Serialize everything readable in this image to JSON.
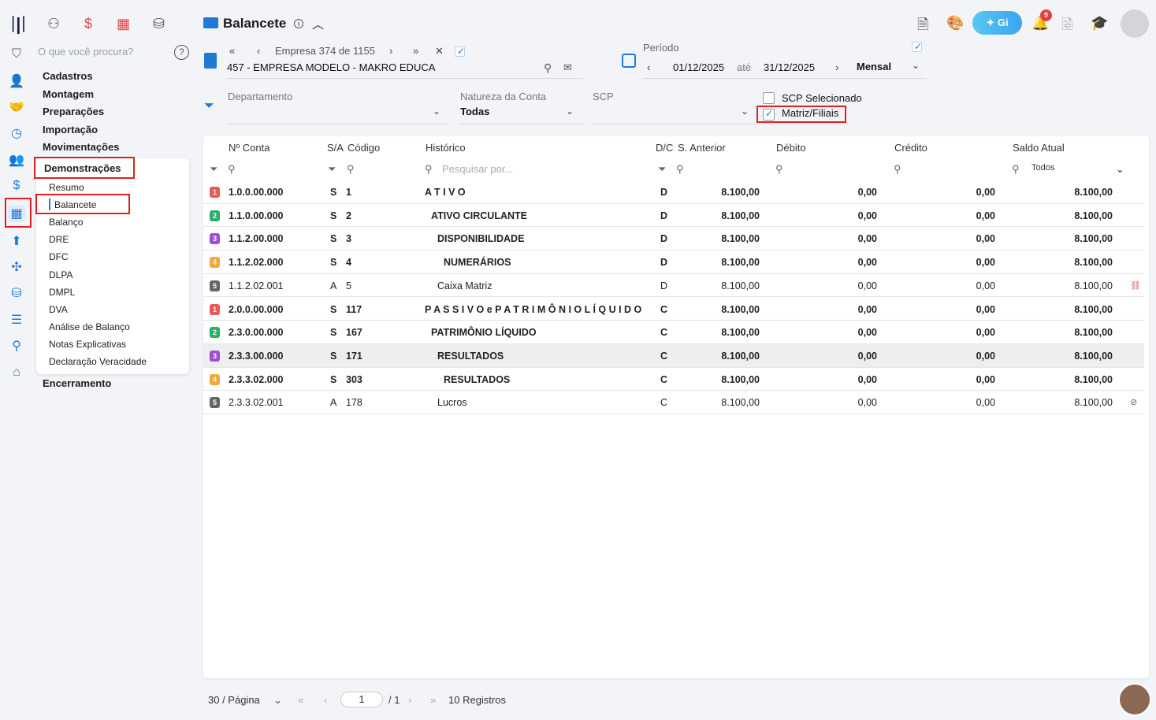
{
  "header": {
    "title": "Balancete",
    "company_nav": "Empresa 374 de 1155",
    "company_name": "457 - EMPRESA MODELO - MAKRO EDUCA",
    "period_label": "Período",
    "date_from": "01/12/2025",
    "date_sep": "até",
    "date_to": "31/12/2025",
    "periodicity": "Mensal",
    "ai_label": "Gi",
    "notif_count": "9"
  },
  "search": {
    "placeholder": "O que você procura?"
  },
  "menu": {
    "items": [
      "Cadastros",
      "Montagem",
      "Preparações",
      "Importação",
      "Movimentações",
      "Demonstrações"
    ],
    "sub": [
      "Resumo",
      "Balancete",
      "Balanço",
      "DRE",
      "DFC",
      "DLPA",
      "DMPL",
      "DVA",
      "Análise de Balanço",
      "Notas Explicativas",
      "Declaração Veracidade"
    ],
    "last": "Encerramento"
  },
  "filters": {
    "dept_label": "Departamento",
    "nature_label": "Natureza da Conta",
    "nature_value": "Todas",
    "scp_label": "SCP",
    "scp_selected": "SCP Selecionado",
    "matriz": "Matriz/Filiais"
  },
  "table": {
    "headers": {
      "conta": "Nº Conta",
      "sa": "S/A",
      "codigo": "Código",
      "historico": "Histórico",
      "dc": "D/C",
      "anterior": "S. Anterior",
      "debito": "Débito",
      "credito": "Crédito",
      "saldo": "Saldo Atual"
    },
    "search_placeholder": "Pesquisar por...",
    "saldo_filter": "Todos",
    "rows": [
      {
        "level": "1",
        "conta": "1.0.0.00.000",
        "sa": "S",
        "codigo": "1",
        "historico": "A T I V O",
        "dc": "D",
        "anterior": "8.100,00",
        "debito": "0,00",
        "credito": "0,00",
        "saldo": "8.100,00",
        "bold": true
      },
      {
        "level": "2",
        "conta": "1.1.0.00.000",
        "sa": "S",
        "codigo": "2",
        "historico": "ATIVO CIRCULANTE",
        "dc": "D",
        "anterior": "8.100,00",
        "debito": "0,00",
        "credito": "0,00",
        "saldo": "8.100,00",
        "bold": true
      },
      {
        "level": "3",
        "conta": "1.1.2.00.000",
        "sa": "S",
        "codigo": "3",
        "historico": "DISPONIBILIDADE",
        "dc": "D",
        "anterior": "8.100,00",
        "debito": "0,00",
        "credito": "0,00",
        "saldo": "8.100,00",
        "bold": true
      },
      {
        "level": "4",
        "conta": "1.1.2.02.000",
        "sa": "S",
        "codigo": "4",
        "historico": "NUMERÁRIOS",
        "dc": "D",
        "anterior": "8.100,00",
        "debito": "0,00",
        "credito": "0,00",
        "saldo": "8.100,00",
        "bold": true
      },
      {
        "level": "5",
        "conta": "1.1.2.02.001",
        "sa": "A",
        "codigo": "5",
        "historico": "Caixa Matriz",
        "dc": "D",
        "anterior": "8.100,00",
        "debito": "0,00",
        "credito": "0,00",
        "saldo": "8.100,00",
        "bold": false
      },
      {
        "level": "1",
        "conta": "2.0.0.00.000",
        "sa": "S",
        "codigo": "117",
        "historico": "P A S S I V O e P A T R I M Ô N I O L Í Q U I D O",
        "dc": "C",
        "anterior": "8.100,00",
        "debito": "0,00",
        "credito": "0,00",
        "saldo": "8.100,00",
        "bold": true
      },
      {
        "level": "2",
        "conta": "2.3.0.00.000",
        "sa": "S",
        "codigo": "167",
        "historico": "PATRIMÔNIO LÍQUIDO",
        "dc": "C",
        "anterior": "8.100,00",
        "debito": "0,00",
        "credito": "0,00",
        "saldo": "8.100,00",
        "bold": true
      },
      {
        "level": "3",
        "conta": "2.3.3.00.000",
        "sa": "S",
        "codigo": "171",
        "historico": "RESULTADOS",
        "dc": "C",
        "anterior": "8.100,00",
        "debito": "0,00",
        "credito": "0,00",
        "saldo": "8.100,00",
        "bold": true
      },
      {
        "level": "4",
        "conta": "2.3.3.02.000",
        "sa": "S",
        "codigo": "303",
        "historico": "RESULTADOS",
        "dc": "C",
        "anterior": "8.100,00",
        "debito": "0,00",
        "credito": "0,00",
        "saldo": "8.100,00",
        "bold": true
      },
      {
        "level": "5",
        "conta": "2.3.3.02.001",
        "sa": "A",
        "codigo": "178",
        "historico": "Lucros",
        "dc": "C",
        "anterior": "8.100,00",
        "debito": "0,00",
        "credito": "0,00",
        "saldo": "8.100,00",
        "bold": false
      }
    ]
  },
  "footer": {
    "per_page": "30 / Página",
    "page": "1",
    "total_pages": "/ 1",
    "records": "10 Registros"
  },
  "colors": {
    "level1": "#e85a5a",
    "level2": "#2cae6a",
    "level3": "#9b4fd6",
    "level4": "#f2a83a",
    "level5": "#666666",
    "accent": "#1f7ad6"
  }
}
